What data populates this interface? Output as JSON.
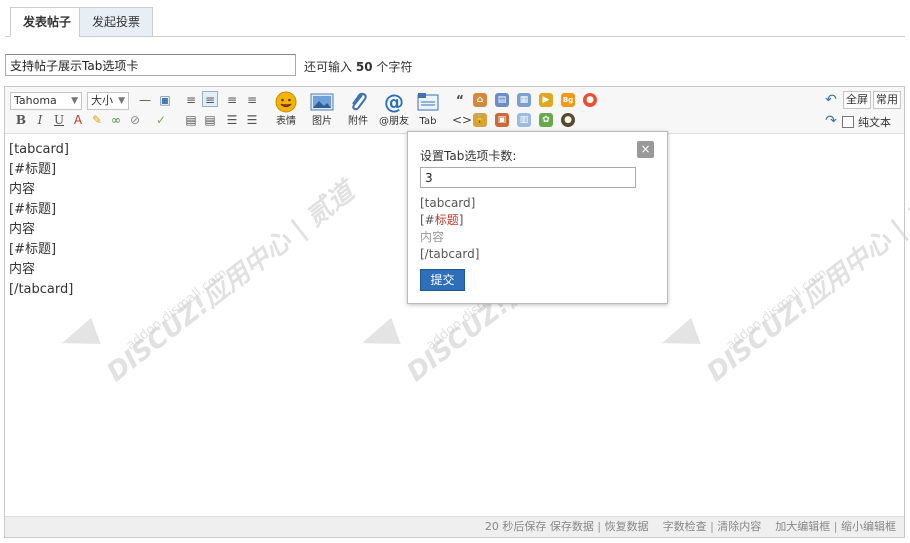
{
  "tabs": [
    {
      "label": "发表帖子",
      "active": true
    },
    {
      "label": "发起投票",
      "active": false
    }
  ],
  "subject": {
    "value": "支持帖子展示Tab选项卡"
  },
  "remain": {
    "prefix": "还可输入",
    "count": "50",
    "suffix": "个字符"
  },
  "toolbar": {
    "font_family": "Tahoma",
    "font_size": "大小",
    "big_buttons": [
      "表情",
      "图片",
      "附件",
      "@朋友",
      "Tab"
    ],
    "fullscreen": "全屏",
    "common": "常用",
    "plaintext": "纯文本"
  },
  "content_lines": [
    "[tabcard]",
    "[#标题]",
    "内容",
    "[#标题]",
    "内容",
    "[#标题]",
    "内容",
    "[/tabcard]"
  ],
  "popup": {
    "title": "设置Tab选项卡数:",
    "value": "3",
    "preview": {
      "line1": "[tabcard]",
      "line2_a": "[#",
      "line2_b": "标题",
      "line2_c": "]",
      "line3": "内容",
      "line4": "[/tabcard]"
    },
    "submit": "提交",
    "close": "×"
  },
  "status": {
    "autosave": "20 秒后保存",
    "save": "保存数据",
    "restore": "恢复数据",
    "check": "字数检查",
    "clear": "清除内容",
    "enlarge": "加大编辑框",
    "shrink": "缩小编辑框"
  },
  "watermark": {
    "brand": "DISCUZ!应用中心 | 贰道",
    "domain": "addon.dismall.com"
  },
  "colors": {
    "accent": "#2e6fba",
    "tab_inactive": "#e8eef6",
    "link_red": "#c0392b"
  }
}
